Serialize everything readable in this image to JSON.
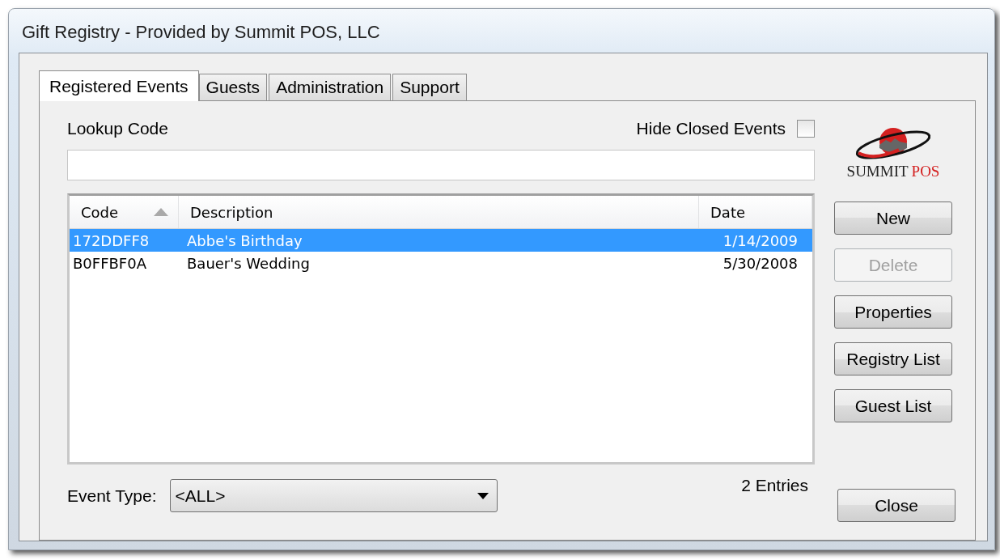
{
  "window": {
    "title": "Gift Registry - Provided by Summit POS, LLC"
  },
  "tabs": [
    {
      "label": "Registered Events",
      "selected": true
    },
    {
      "label": "Guests",
      "selected": false
    },
    {
      "label": "Administration",
      "selected": false
    },
    {
      "label": "Support",
      "selected": false
    }
  ],
  "lookup": {
    "label": "Lookup Code"
  },
  "hide_closed": {
    "label": "Hide Closed Events",
    "checked": false
  },
  "logo": {
    "brand": "SUMMIT",
    "product": "POS"
  },
  "table": {
    "columns": [
      {
        "label": "Code",
        "sorted": true
      },
      {
        "label": "Description",
        "sorted": false
      },
      {
        "label": "Date",
        "sorted": false
      }
    ],
    "rows": [
      {
        "cells": [
          "172DDFF8",
          "Abbe's Birthday",
          "1/14/2009"
        ],
        "selected": true
      },
      {
        "cells": [
          "B0FFBF0A",
          "Bauer's Wedding",
          "5/30/2008"
        ],
        "selected": false
      }
    ]
  },
  "event_type": {
    "label": "Event Type:",
    "value": "<ALL>"
  },
  "entries": "2 Entries",
  "buttons": [
    {
      "label": "New",
      "disabled": false
    },
    {
      "label": "Delete",
      "disabled": true
    },
    {
      "label": "Properties",
      "disabled": false
    },
    {
      "label": "Registry List",
      "disabled": false
    },
    {
      "label": "Guest List",
      "disabled": false
    }
  ],
  "close_button": {
    "label": "Close"
  }
}
